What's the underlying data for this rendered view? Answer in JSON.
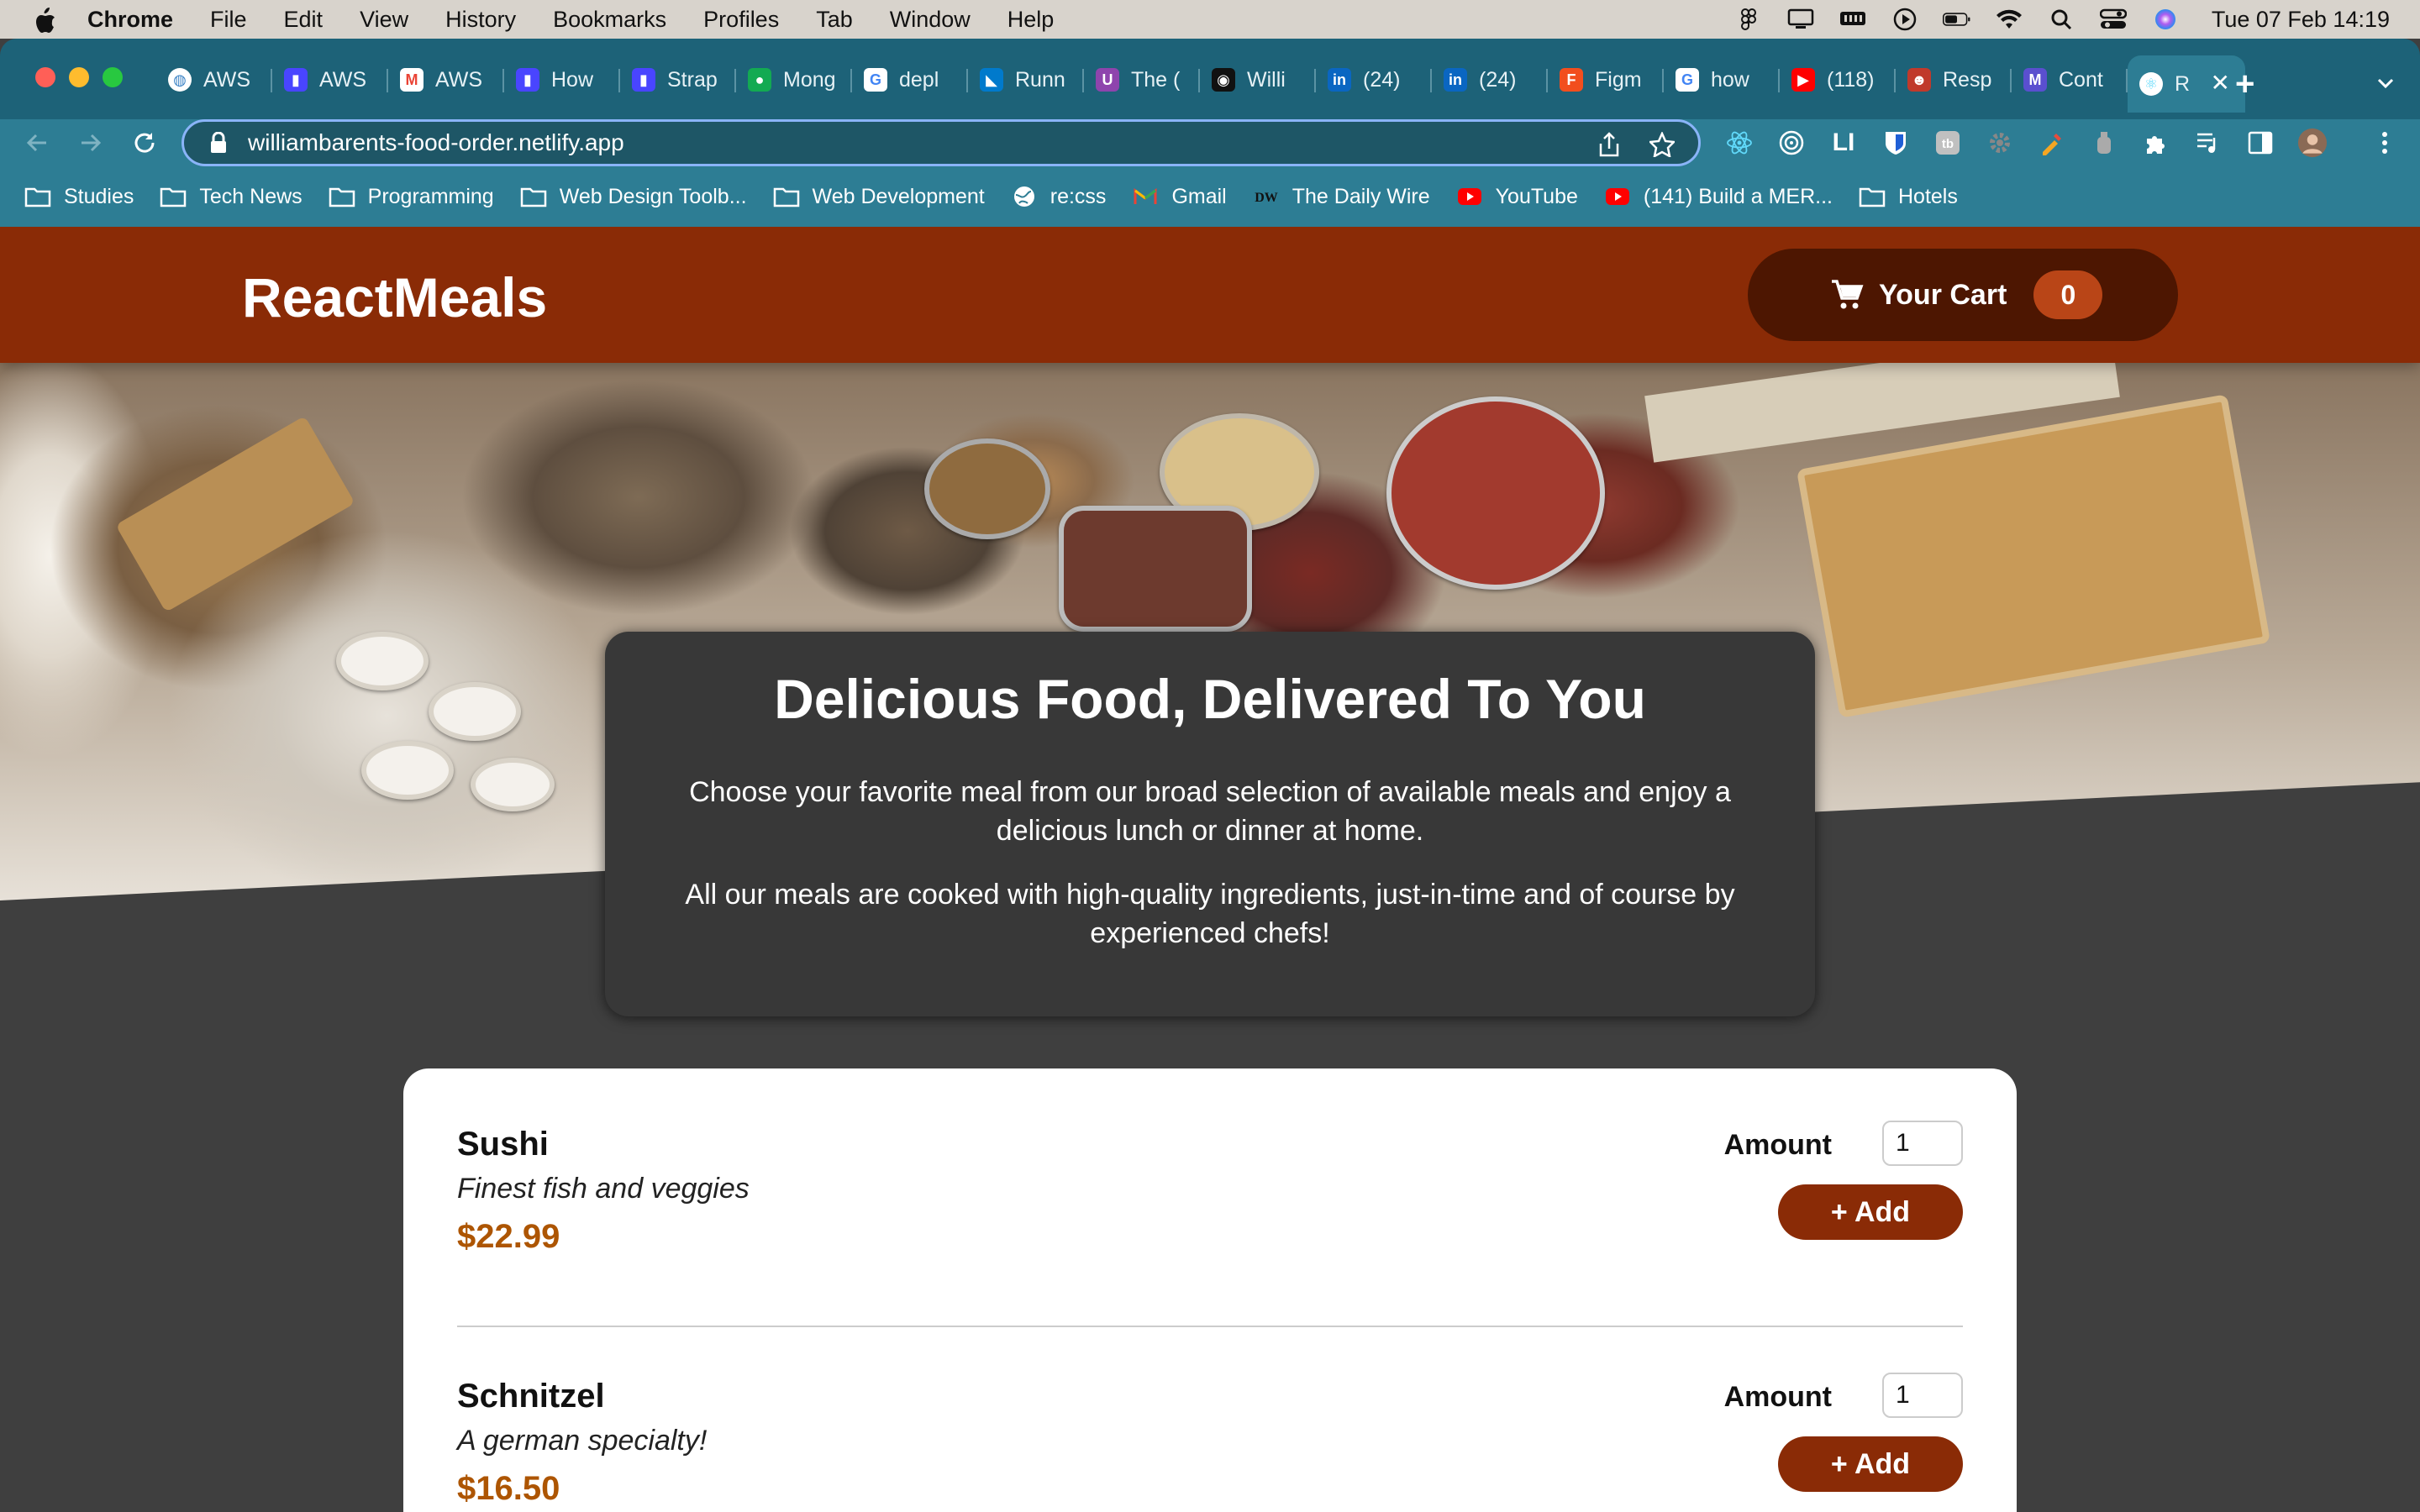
{
  "menubar": {
    "app": "Chrome",
    "items": [
      "File",
      "Edit",
      "View",
      "History",
      "Bookmarks",
      "Profiles",
      "Tab",
      "Window",
      "Help"
    ],
    "clock": "Tue 07 Feb  14:19"
  },
  "tabs": [
    {
      "label": "AWS",
      "icon": "globe-icon",
      "color": "#3b82c4"
    },
    {
      "label": "AWS",
      "icon": "strapi-icon",
      "color": "#4945ff"
    },
    {
      "label": "AWS",
      "icon": "gmail-icon",
      "color": "#ea4335"
    },
    {
      "label": "How",
      "icon": "strapi-icon",
      "color": "#4945ff"
    },
    {
      "label": "Strap",
      "icon": "strapi-icon",
      "color": "#4945ff"
    },
    {
      "label": "Mong",
      "icon": "mongodb-icon",
      "color": "#13aa52"
    },
    {
      "label": "depl",
      "icon": "google-icon",
      "color": "#4285f4"
    },
    {
      "label": "Runn",
      "icon": "vscode-icon",
      "color": "#007acc"
    },
    {
      "label": "The (",
      "icon": "ublock-icon",
      "color": "#8e44ad"
    },
    {
      "label": "Willi",
      "icon": "github-icon",
      "color": "#111111"
    },
    {
      "label": "(24)",
      "icon": "linkedin-icon",
      "color": "#0a66c2"
    },
    {
      "label": "(24)",
      "icon": "linkedin-icon",
      "color": "#0a66c2"
    },
    {
      "label": "Figm",
      "icon": "figma-icon",
      "color": "#f24e1e"
    },
    {
      "label": "how",
      "icon": "google-icon",
      "color": "#4285f4"
    },
    {
      "label": "(118)",
      "icon": "youtube-icon",
      "color": "#ff0000"
    },
    {
      "label": "Resp",
      "icon": "sponsor-icon",
      "color": "#c0392b"
    },
    {
      "label": "Cont",
      "icon": "m-icon",
      "color": "#5a4fcf"
    },
    {
      "label": "R",
      "icon": "react-icon",
      "color": "#61dafb",
      "active": true
    }
  ],
  "address": {
    "url": "williambarents-food-order.netlify.app"
  },
  "bookmarks": [
    {
      "label": "Studies",
      "icon": "folder-icon"
    },
    {
      "label": "Tech News",
      "icon": "folder-icon"
    },
    {
      "label": "Programming",
      "icon": "folder-icon"
    },
    {
      "label": "Web Design Toolb...",
      "icon": "folder-icon"
    },
    {
      "label": "Web Development",
      "icon": "folder-icon"
    },
    {
      "label": "re:css",
      "icon": "globe-icon"
    },
    {
      "label": "Gmail",
      "icon": "gmail-icon"
    },
    {
      "label": "The Daily Wire",
      "icon": "dw-icon"
    },
    {
      "label": "YouTube",
      "icon": "youtube-icon"
    },
    {
      "label": "(141) Build a MER...",
      "icon": "youtube-icon"
    },
    {
      "label": "Hotels",
      "icon": "folder-icon"
    }
  ],
  "header": {
    "logo": "ReactMeals",
    "cart_label": "Your Cart",
    "cart_count": "0"
  },
  "summary": {
    "title": "Delicious Food, Delivered To You",
    "p1": "Choose your favorite meal from our broad selection of available meals and enjoy a delicious lunch or dinner at home.",
    "p2": "All our meals are cooked with high-quality ingredients, just-in-time and of course by experienced chefs!"
  },
  "meals": [
    {
      "name": "Sushi",
      "description": "Finest fish and veggies",
      "price": "$22.99",
      "amount_label": "Amount",
      "amount": "1",
      "add_label": "+ Add"
    },
    {
      "name": "Schnitzel",
      "description": "A german specialty!",
      "price": "$16.50",
      "amount_label": "Amount",
      "amount": "1",
      "add_label": "+ Add"
    }
  ],
  "colors": {
    "header": "#8a2b06",
    "cart_button": "#4d1601",
    "badge": "#b94517",
    "price": "#ad5502",
    "chrome_frame": "#2d7d94"
  }
}
